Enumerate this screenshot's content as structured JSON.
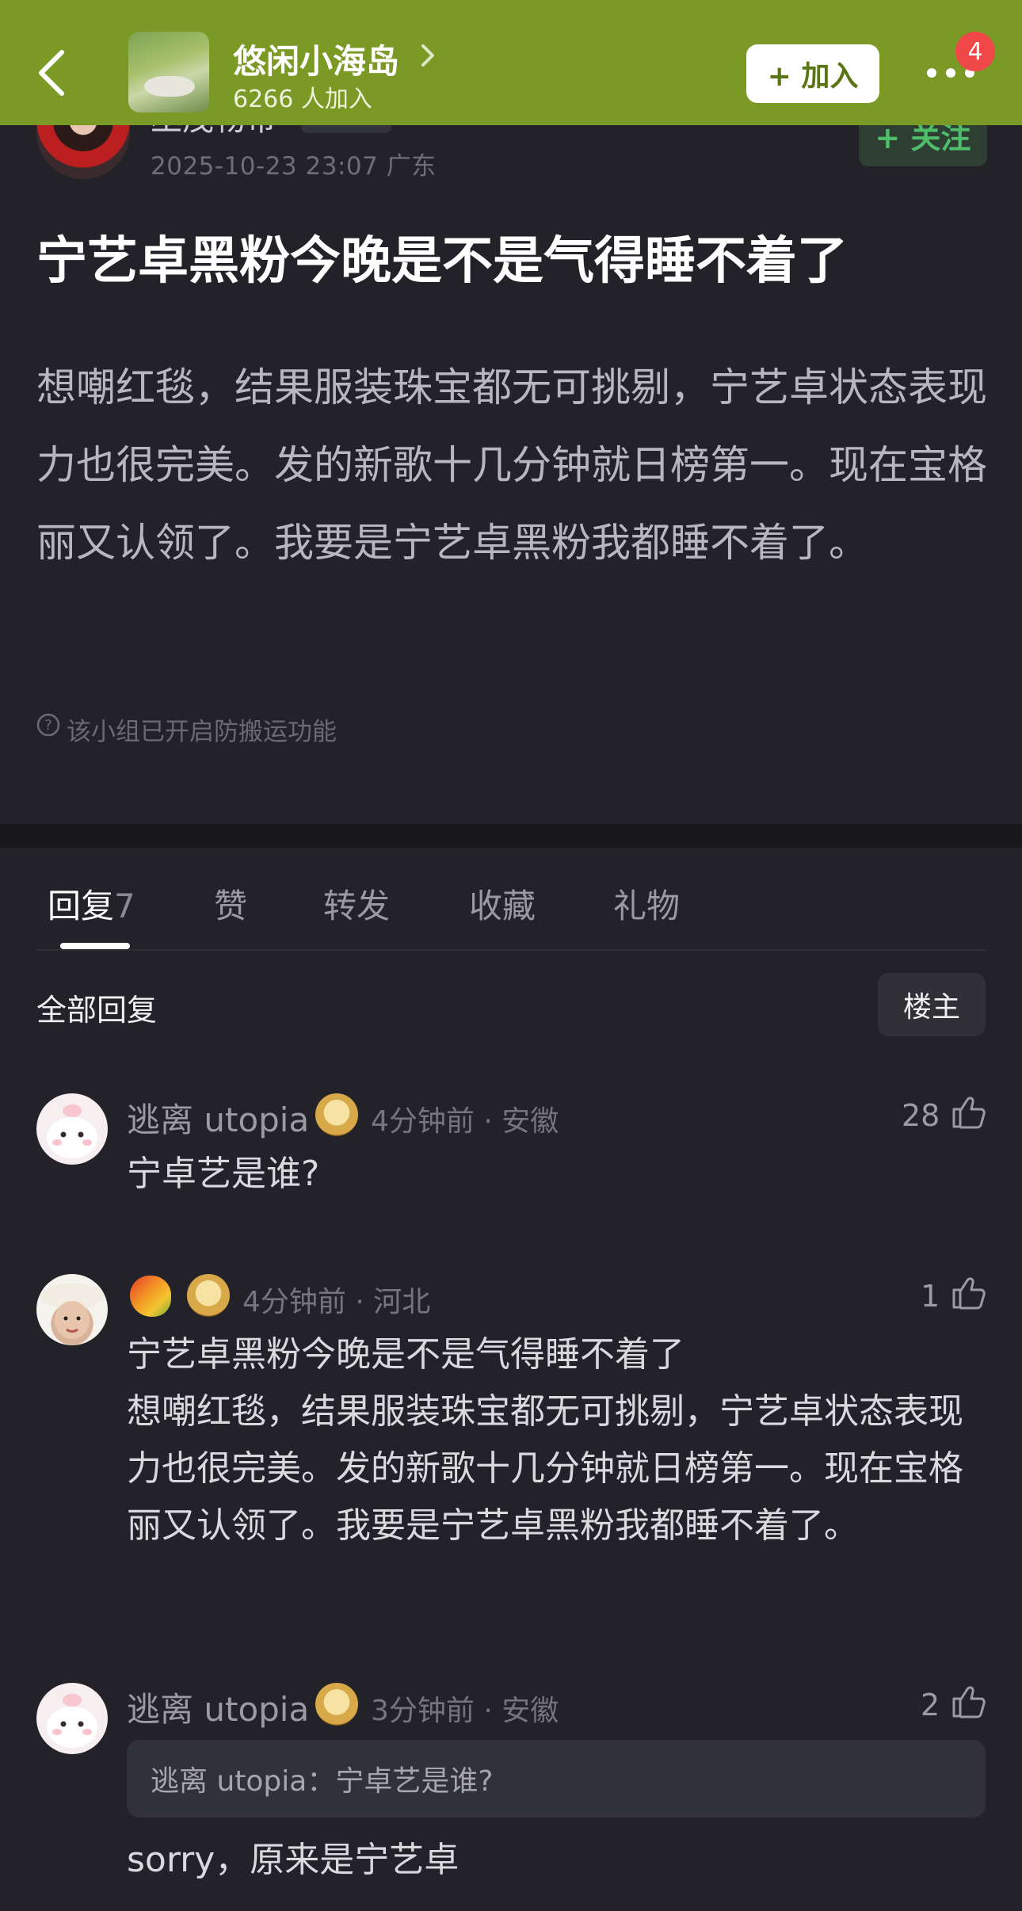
{
  "header": {
    "group_name": "悠闲小海岛",
    "member_count": "6266 人加入",
    "join_label": "+ 加入",
    "notification_count": "4"
  },
  "post": {
    "author_name": "巫茂物带",
    "meta": "2025-10-23 23:07  广东",
    "follow_label": "+ 关注",
    "title": "宁艺卓黑粉今晚是不是气得睡不着了",
    "body": "想嘲红毯，结果服装珠宝都无可挑剔，宁艺卓状态表现力也很完美。发的新歌十几分钟就日榜第一。现在宝格丽又认领了。我要是宁艺卓黑粉我都睡不着了。",
    "protect_notice": "该小组已开启防搬运功能"
  },
  "tabs": [
    {
      "label": "回复",
      "count": "7"
    },
    {
      "label": "赞"
    },
    {
      "label": "转发"
    },
    {
      "label": "收藏"
    },
    {
      "label": "礼物"
    }
  ],
  "replies_header": {
    "title": "全部回复",
    "op_filter": "楼主"
  },
  "comments": [
    {
      "name": "逃离 utopia",
      "meta": "4分钟前 · 安徽",
      "likes": "28",
      "text": "宁卓艺是谁?"
    },
    {
      "name": "",
      "meta": "4分钟前 · 河北",
      "likes": "1",
      "text": "宁艺卓黑粉今晚是不是气得睡不着了\n想嘲红毯，结果服装珠宝都无可挑剔，宁艺卓状态表现力也很完美。发的新歌十几分钟就日榜第一。现在宝格丽又认领了。我要是宁艺卓黑粉我都睡不着了。"
    },
    {
      "name": "逃离 utopia",
      "meta": "3分钟前 · 安徽",
      "likes": "2",
      "quote": "逃离 utopia：宁卓艺是谁?",
      "text": "sorry，原来是宁艺卓"
    }
  ],
  "colors": {
    "header_bg": "#7a9925",
    "page_bg": "#232229",
    "follow_green": "#4fbe6a",
    "badge_red": "#f04848"
  }
}
